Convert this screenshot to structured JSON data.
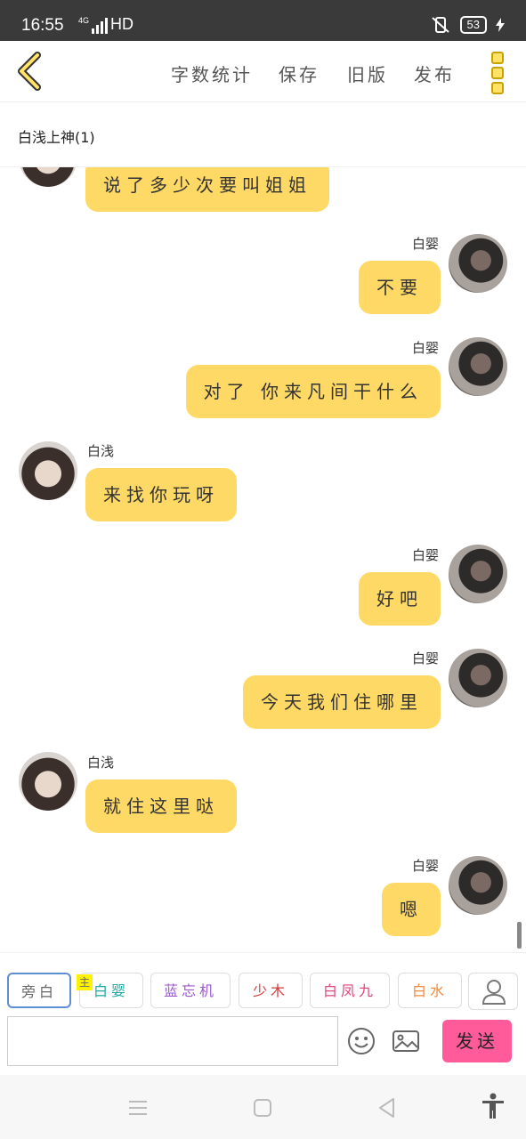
{
  "status_bar": {
    "time": "16:55",
    "network": "4G",
    "hd": "HD",
    "battery": "53"
  },
  "toolbar": {
    "word_count": "字数统计",
    "save": "保存",
    "old_version": "旧版",
    "publish": "发布"
  },
  "conversation": {
    "title": "白浅上神(1)"
  },
  "messages": [
    {
      "side": "left",
      "name": "",
      "text": "说了多少次要叫姐姐"
    },
    {
      "side": "right",
      "name": "白婴",
      "text": "不要"
    },
    {
      "side": "right",
      "name": "白婴",
      "text": "对了 你来凡间干什么"
    },
    {
      "side": "left",
      "name": "白浅",
      "text": "来找你玩呀"
    },
    {
      "side": "right",
      "name": "白婴",
      "text": "好吧"
    },
    {
      "side": "right",
      "name": "白婴",
      "text": "今天我们住哪里"
    },
    {
      "side": "left",
      "name": "白浅",
      "text": "就住这里哒"
    },
    {
      "side": "right",
      "name": "白婴",
      "text": "嗯"
    }
  ],
  "characters": [
    {
      "label": "旁白",
      "color": "#666666"
    },
    {
      "label": "白婴",
      "color": "#1aa8a0"
    },
    {
      "label": "蓝忘机",
      "color": "#9b59d0"
    },
    {
      "label": "少木",
      "color": "#d23b3b"
    },
    {
      "label": "白凤九",
      "color": "#e0457b"
    },
    {
      "label": "白水",
      "color": "#f08a3c"
    }
  ],
  "main_tag": "主",
  "input": {
    "value": "",
    "send_label": "发送"
  },
  "colors": {
    "bubble": "#ffd966",
    "send_button": "#ff5b9a",
    "accent_yellow": "#ffe266"
  },
  "icons": [
    "back-chevron-icon",
    "more-menu-icon",
    "person-icon",
    "emoji-icon",
    "image-icon",
    "menu-lines-icon",
    "home-square-icon",
    "back-triangle-icon",
    "accessibility-icon"
  ]
}
